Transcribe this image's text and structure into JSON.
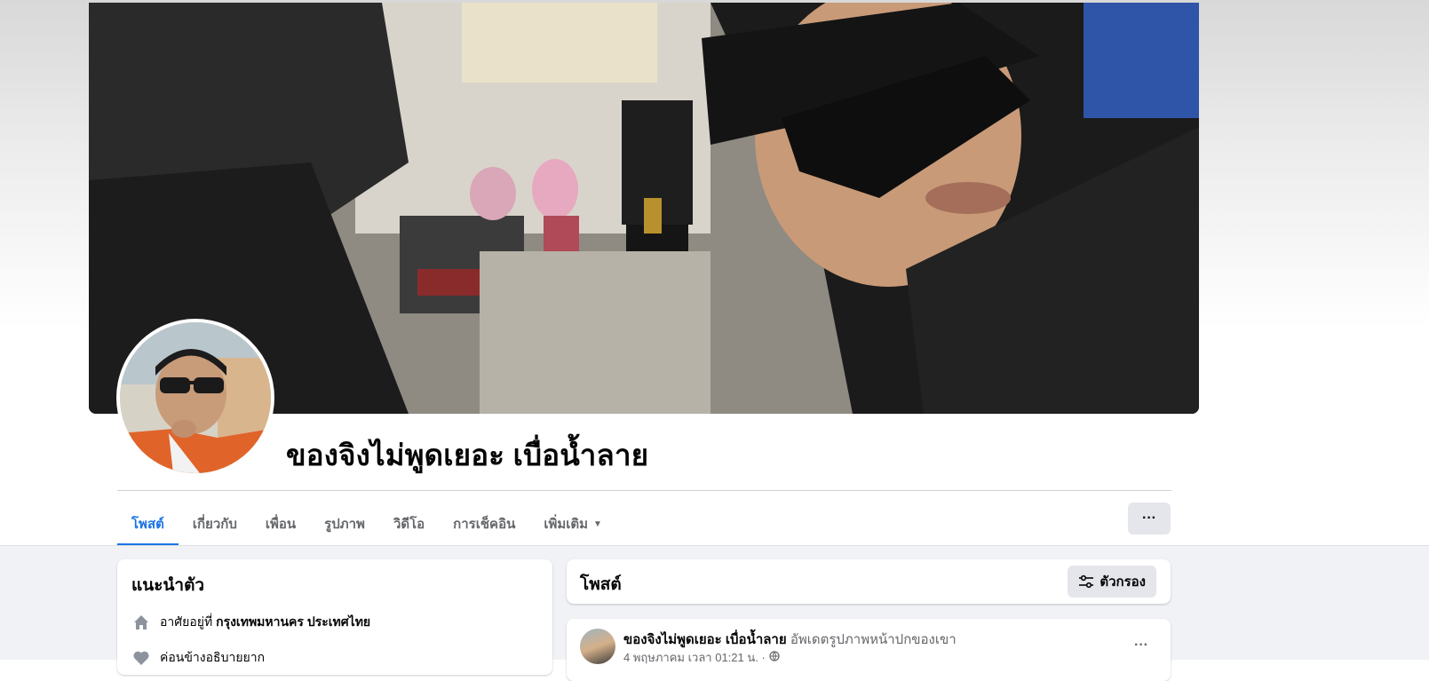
{
  "profile": {
    "name": "ของจิงไม่พูดเยอะ เบื่อน้ำลาย"
  },
  "tabs": [
    {
      "label": "โพสต์",
      "active": true
    },
    {
      "label": "เกี่ยวกับ",
      "active": false
    },
    {
      "label": "เพื่อน",
      "active": false
    },
    {
      "label": "รูปภาพ",
      "active": false
    },
    {
      "label": "วิดีโอ",
      "active": false
    },
    {
      "label": "การเช็คอิน",
      "active": false
    },
    {
      "label": "เพิ่มเติม",
      "active": false
    }
  ],
  "more_button": "···",
  "intro": {
    "title": "แนะนำตัว",
    "lives_prefix": "อาศัยอยู่ที่",
    "lives_place": "กรุงเทพมหานคร ประเทศไทย",
    "relationship": "ค่อนข้างอธิบายยาก"
  },
  "posts": {
    "title": "โพสต์",
    "filter_label": "ตัวกรอง"
  },
  "post": {
    "author": "ของจิงไม่พูดเยอะ เบื่อน้ำลาย",
    "action": "อัพเดตรูปภาพหน้าปกของเขา",
    "time": "4 พฤษภาคม เวลา 01:21 น. ·",
    "menu": "···"
  },
  "colors": {
    "accent": "#1b74e4",
    "secondary_text": "#65676b",
    "button_bg": "#e4e6eb",
    "page_bg": "#f0f2f5"
  }
}
